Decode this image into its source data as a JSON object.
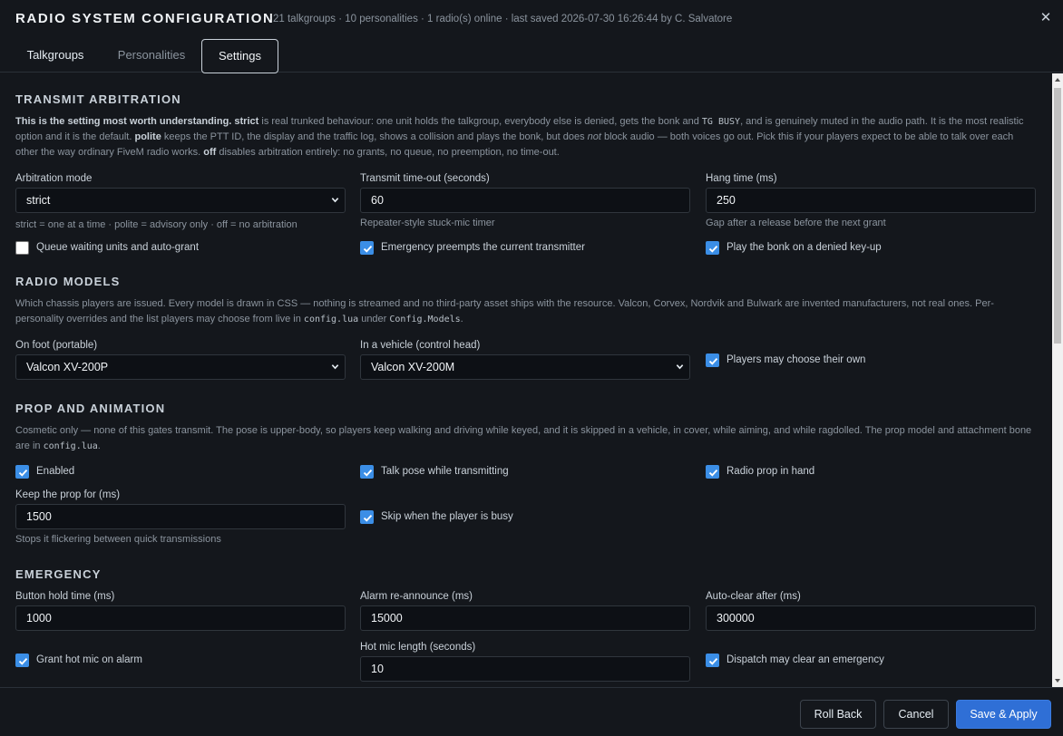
{
  "app": {
    "title": "RADIO SYSTEM CONFIGURATION",
    "meta": "21 talkgroups · 10 personalities · 1 radio(s) online · last saved 2026-07-30 16:26:44 by C. Salvatore",
    "close_glyph": "✕"
  },
  "tabs": [
    {
      "label": "Talkgroups",
      "active": false
    },
    {
      "label": "Personalities",
      "active": false
    },
    {
      "label": "Settings",
      "active": true
    }
  ],
  "transmit": {
    "title": "TRANSMIT ARBITRATION",
    "desc_1_bold": "This is the setting most worth understanding.",
    "desc_2_bold": "strict",
    "desc_3": " is real trunked behaviour: one unit holds the talkgroup, everybody else is denied, gets the bonk and ",
    "desc_4_code": "TG BUSY",
    "desc_5": ", and is genuinely muted in the audio path. It is the most realistic option and it is the default. ",
    "desc_6_bold": "polite",
    "desc_7": " keeps the PTT ID, the display and the traffic log, shows a collision and plays the bonk, but does ",
    "desc_8_em": "not",
    "desc_9": " block audio — both voices go out. Pick this if your players expect to be able to talk over each other the way ordinary FiveM radio works. ",
    "desc_10_bold": "off",
    "desc_11": " disables arbitration entirely: no grants, no queue, no preemption, no time-out.",
    "mode_label": "Arbitration mode",
    "mode_value": "strict",
    "mode_hint": "strict = one at a time · polite = advisory only · off = no arbitration",
    "timeout_label": "Transmit time-out (seconds)",
    "timeout_value": "60",
    "timeout_hint": "Repeater-style stuck-mic timer",
    "hang_label": "Hang time (ms)",
    "hang_value": "250",
    "hang_hint": "Gap after a release before the next grant",
    "queue_label": "Queue waiting units and auto-grant",
    "queue_checked": false,
    "preempt_label": "Emergency preempts the current transmitter",
    "preempt_checked": true,
    "bonk_label": "Play the bonk on a denied key-up",
    "bonk_checked": true
  },
  "models": {
    "title": "RADIO MODELS",
    "desc_1": "Which chassis players are issued. Every model is drawn in CSS — nothing is streamed and no third-party asset ships with the resource. Valcon, Corvex, Nordvik and Bulwark are invented manufacturers, not real ones. Per-personality overrides and the list players may choose from live in ",
    "desc_2_code": "config.lua",
    "desc_3": " under ",
    "desc_4_code": "Config.Models",
    "desc_5": ".",
    "foot_label": "On foot (portable)",
    "foot_value": "Valcon XV-200P",
    "vehicle_label": "In a vehicle (control head)",
    "vehicle_value": "Valcon XV-200M",
    "choose_label": "Players may choose their own",
    "choose_checked": true
  },
  "prop": {
    "title": "PROP AND ANIMATION",
    "desc_1": "Cosmetic only — none of this gates transmit. The pose is upper-body, so players keep walking and driving while keyed, and it is skipped in a vehicle, in cover, while aiming, and while ragdolled. The prop model and attachment bone are in ",
    "desc_2_code": "config.lua",
    "desc_3": ".",
    "enabled_label": "Enabled",
    "enabled_checked": true,
    "pose_label": "Talk pose while transmitting",
    "pose_checked": true,
    "inhand_label": "Radio prop in hand",
    "inhand_checked": true,
    "keep_label": "Keep the prop for (ms)",
    "keep_value": "1500",
    "keep_hint": "Stops it flickering between quick transmissions",
    "skip_label": "Skip when the player is busy",
    "skip_checked": true
  },
  "emergency": {
    "title": "EMERGENCY",
    "hold_label": "Button hold time (ms)",
    "hold_value": "1000",
    "reannounce_label": "Alarm re-announce (ms)",
    "reannounce_value": "15000",
    "autoclear_label": "Auto-clear after (ms)",
    "autoclear_value": "300000",
    "hotmic_label": "Grant hot mic on alarm",
    "hotmic_checked": true,
    "hotmic_len_label": "Hot mic length (seconds)",
    "hotmic_len_value": "10",
    "dispatch_label": "Dispatch may clear an emergency",
    "dispatch_checked": true
  },
  "footer": {
    "rollback_label": "Roll Back",
    "cancel_label": "Cancel",
    "save_label": "Save & Apply"
  },
  "colors": {
    "background": "#14171c",
    "field": "#0d1015",
    "accent": "#3b8ee6",
    "primary_button": "#2f6fd6"
  }
}
